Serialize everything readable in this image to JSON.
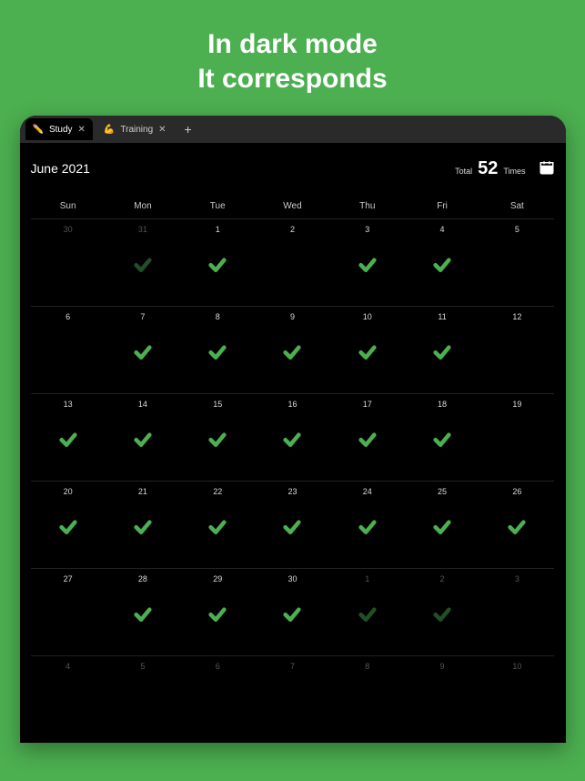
{
  "headline": {
    "line1": "In dark mode",
    "line2": "It corresponds"
  },
  "tabs": [
    {
      "icon": "✏️",
      "label": "Study",
      "active": true
    },
    {
      "icon": "💪",
      "label": "Training",
      "active": false
    }
  ],
  "month": "June 2021",
  "total": {
    "label": "Total",
    "value": "52",
    "unit": "Times"
  },
  "dow": [
    "Sun",
    "Mon",
    "Tue",
    "Wed",
    "Thu",
    "Fri",
    "Sat"
  ],
  "weeks": [
    [
      {
        "n": "30",
        "type": "prev",
        "check": false
      },
      {
        "n": "31",
        "type": "prev",
        "check": true,
        "faded": true
      },
      {
        "n": "1",
        "type": "",
        "check": true
      },
      {
        "n": "2",
        "type": "",
        "check": false
      },
      {
        "n": "3",
        "type": "",
        "check": true
      },
      {
        "n": "4",
        "type": "",
        "check": true
      },
      {
        "n": "5",
        "type": "",
        "check": false
      }
    ],
    [
      {
        "n": "6",
        "type": "",
        "check": false
      },
      {
        "n": "7",
        "type": "",
        "check": true
      },
      {
        "n": "8",
        "type": "",
        "check": true
      },
      {
        "n": "9",
        "type": "",
        "check": true
      },
      {
        "n": "10",
        "type": "",
        "check": true
      },
      {
        "n": "11",
        "type": "",
        "check": true
      },
      {
        "n": "12",
        "type": "",
        "check": false
      }
    ],
    [
      {
        "n": "13",
        "type": "",
        "check": true
      },
      {
        "n": "14",
        "type": "",
        "check": true
      },
      {
        "n": "15",
        "type": "",
        "check": true
      },
      {
        "n": "16",
        "type": "",
        "check": true
      },
      {
        "n": "17",
        "type": "",
        "check": true
      },
      {
        "n": "18",
        "type": "",
        "check": true
      },
      {
        "n": "19",
        "type": "",
        "check": false
      }
    ],
    [
      {
        "n": "20",
        "type": "",
        "check": true
      },
      {
        "n": "21",
        "type": "",
        "check": true
      },
      {
        "n": "22",
        "type": "",
        "check": true
      },
      {
        "n": "23",
        "type": "",
        "check": true
      },
      {
        "n": "24",
        "type": "",
        "check": true
      },
      {
        "n": "25",
        "type": "",
        "check": true
      },
      {
        "n": "26",
        "type": "",
        "check": true
      }
    ],
    [
      {
        "n": "27",
        "type": "",
        "check": false
      },
      {
        "n": "28",
        "type": "",
        "check": true
      },
      {
        "n": "29",
        "type": "",
        "check": true
      },
      {
        "n": "30",
        "type": "",
        "check": true
      },
      {
        "n": "1",
        "type": "next",
        "check": true,
        "faded": true
      },
      {
        "n": "2",
        "type": "next",
        "check": true,
        "faded": true
      },
      {
        "n": "3",
        "type": "next",
        "check": false
      }
    ],
    [
      {
        "n": "4",
        "type": "next",
        "check": false
      },
      {
        "n": "5",
        "type": "next",
        "check": false
      },
      {
        "n": "6",
        "type": "next",
        "check": false
      },
      {
        "n": "7",
        "type": "next",
        "check": false
      },
      {
        "n": "8",
        "type": "next",
        "check": false
      },
      {
        "n": "9",
        "type": "next",
        "check": false
      },
      {
        "n": "10",
        "type": "next",
        "check": false
      }
    ]
  ]
}
